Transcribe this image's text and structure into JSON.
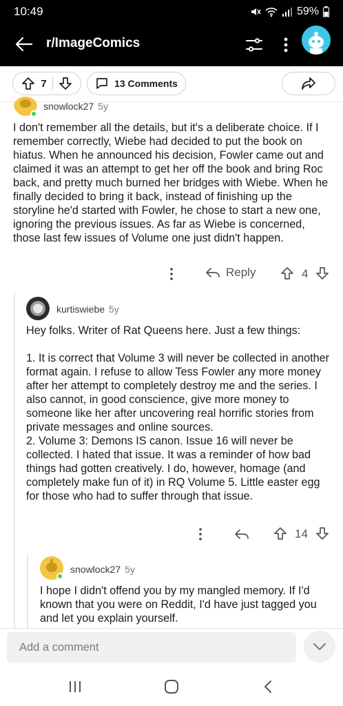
{
  "status_bar": {
    "time": "10:49",
    "battery": "59%",
    "icons": [
      "mute-icon",
      "wifi-icon",
      "signal-icon",
      "battery-icon"
    ]
  },
  "app_bar": {
    "title": "r/ImageComics",
    "icons": [
      "back-arrow-icon",
      "filter-icon",
      "more-vertical-icon",
      "avatar"
    ]
  },
  "post_actions": {
    "upvotes": "7",
    "comments_label": "13 Comments",
    "icons": [
      "upvote-icon",
      "downvote-icon",
      "comment-icon",
      "share-icon"
    ]
  },
  "comments": [
    {
      "username": "snowlock27",
      "age": "5y",
      "body": "I don't remember all the details, but it's a deliberate choice.  If I remember correctly, Wiebe had decided to put the book on hiatus.  When he announced his decision, Fowler came out and claimed it was an attempt to get her off the book and bring Roc back, and pretty much burned her bridges with Wiebe.  When he finally decided to bring it back, instead of finishing up the storyline he'd started with Fowler, he chose to start a new one, ignoring the previous issues.  As far as Wiebe is concerned, those last few issues of Volume one just didn't happen.",
      "reply_label": "Reply",
      "score": "4"
    },
    {
      "username": "kurtiswiebe",
      "age": "5y",
      "body": "Hey folks. Writer of Rat Queens here. Just a few things:\n\n1. It is correct that Volume 3 will never be collected in another format again. I refuse to allow Tess Fowler any more money after her attempt to completely destroy me and the series. I also cannot, in good conscience, give more money to someone like her after uncovering real horrific stories from private messages and online sources.\n2. Volume 3: Demons IS canon. Issue 16 will never be collected. I hated that issue. It was a reminder of how bad things had gotten creatively. I do, however, homage (and completely make fun of it) in RQ Volume 5. Little easter egg for those who had to suffer through that issue.",
      "score": "14"
    },
    {
      "username": "snowlock27",
      "age": "5y",
      "body": "I hope I didn't offend you by my mangled memory.  If I'd known that you were on Reddit, I'd have just tagged you and let you explain yourself."
    }
  ],
  "composer": {
    "placeholder": "Add a comment"
  },
  "colors": {
    "online": "#46d160",
    "avatar_blue": "#3ec6e6",
    "avatar_yellow": "#f4c542"
  }
}
